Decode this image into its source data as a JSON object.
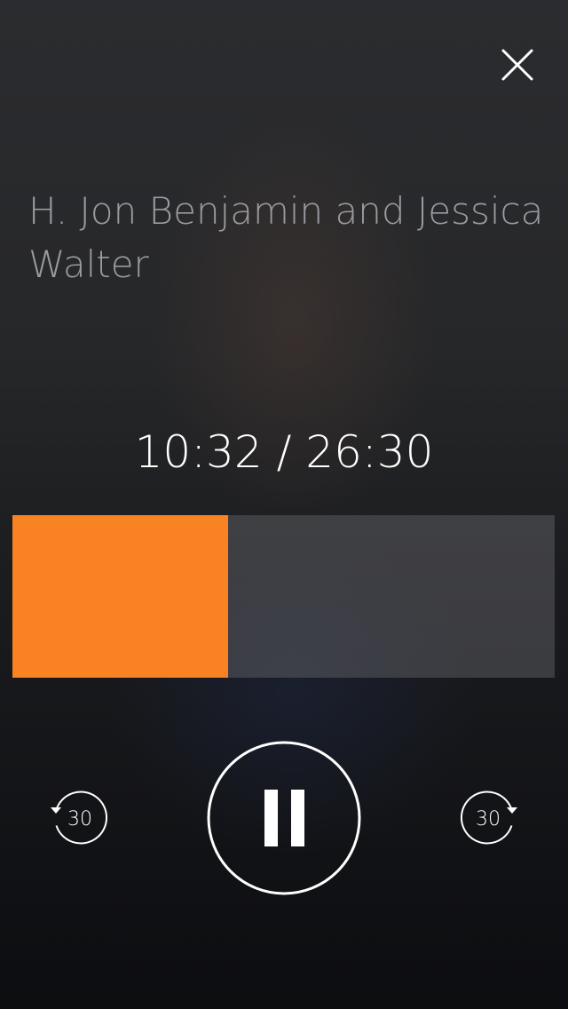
{
  "player": {
    "close_icon": "close-icon",
    "title": "H. Jon Benjamin and Jessica Walter",
    "current_time": "10:32",
    "total_time": "26:30",
    "time_display": "10:32 / 26:30",
    "progress_fraction": 0.397,
    "accent_color": "#f98322",
    "controls": {
      "skip_back_label": "30",
      "skip_back_icon": "rewind-30-icon",
      "pause_icon": "pause-icon",
      "skip_forward_label": "30",
      "skip_forward_icon": "forward-30-icon"
    }
  }
}
